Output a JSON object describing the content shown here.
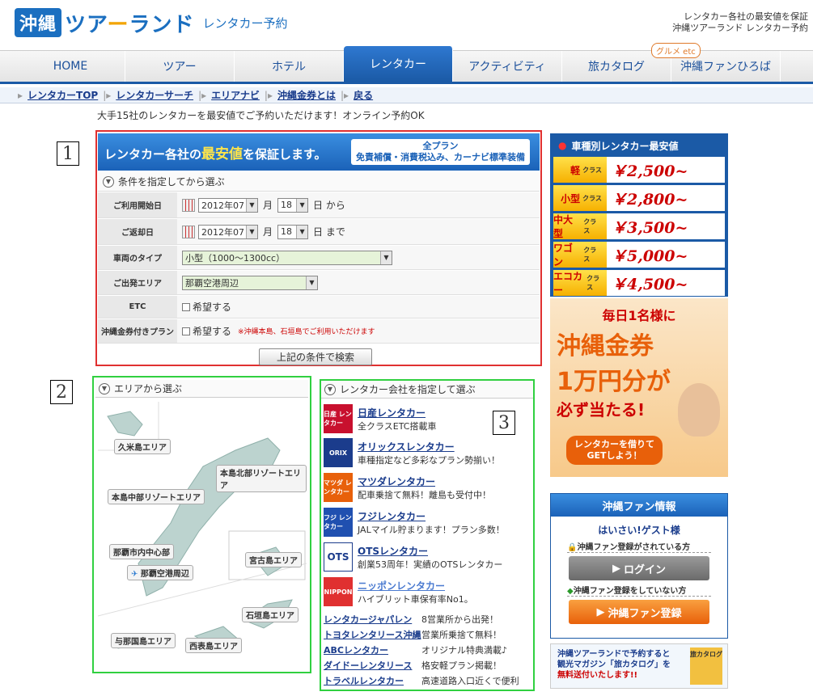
{
  "header": {
    "logo_okinawa": "沖縄",
    "logo_tour": "ツア",
    "logo_smile": "ー",
    "logo_land": "ランド",
    "logo_sub": "レンタカー予約",
    "right_line1": "レンタカー各社の最安値を保証",
    "right_line2": "沖縄ツアーランド レンタカー予約"
  },
  "nav": {
    "items": [
      "HOME",
      "ツアー",
      "ホテル",
      "レンタカー",
      "アクティビティ",
      "旅カタログ",
      "沖縄ファンひろば"
    ],
    "active": "レンタカー",
    "badge": "グルメ etc"
  },
  "subnav": {
    "items": [
      "レンタカーTOP",
      "レンタカーサーチ",
      "エリアナビ",
      "沖縄金券とは",
      "戻る"
    ]
  },
  "intro": "大手15社のレンタカーを最安値でご予約いただけます！オンライン予約OK",
  "annot": {
    "n1": "1",
    "n2": "2",
    "n3": "3"
  },
  "search": {
    "banner_pre": "レンタカー各社の",
    "banner_em": "最安値",
    "banner_post": "を保証します。",
    "banner_right1": "全プラン",
    "banner_right2": "免責補償・消費税込み、カーナビ標準装備",
    "head": "条件を指定してから選ぶ",
    "start_label": "ご利用開始日",
    "start_month": "2012年07",
    "start_day": "18",
    "month_unit": "月",
    "start_suffix": "日 から",
    "return_label": "ご返却日",
    "return_month": "2012年07",
    "return_day": "18",
    "return_suffix": "日 まで",
    "type_label": "車両のタイプ",
    "type_value": "小型（1000〜1300cc）",
    "area_label": "ご出発エリア",
    "area_value": "那覇空港周辺",
    "etc_label": "ETC",
    "etc_check": "希望する",
    "kinken_label": "沖縄金券付きプラン",
    "kinken_check": "希望する",
    "kinken_note": "※沖縄本島、石垣島でご利用いただけます",
    "button": "上記の条件で検索"
  },
  "area": {
    "head": "エリアから選ぶ",
    "labels": [
      "久米島エリア",
      "本島北部リゾートエリア",
      "本島中部リゾートエリア",
      "那覇市内中心部",
      "那覇空港周辺",
      "宮古島エリア",
      "石垣島エリア",
      "与那国島エリア",
      "西表島エリア"
    ]
  },
  "companies": {
    "head": "レンタカー会社を指定して選ぶ",
    "list": [
      {
        "logo": "日産 レンタカー",
        "name": "日産レンタカー",
        "desc": "全クラスETC搭載車",
        "color": "#c8102e"
      },
      {
        "logo": "ORIX",
        "name": "オリックスレンタカー",
        "desc": "車種指定など多彩なプラン勢揃い！",
        "color": "#1b3c8c"
      },
      {
        "logo": "マツダ レンタカー",
        "name": "マツダレンタカー",
        "desc": "配車乗捨て無料！離島も受付中！",
        "color": "#e8600a"
      },
      {
        "logo": "フジ レンタカー",
        "name": "フジレンタカー",
        "desc": "JALマイル貯まります！プラン多数！",
        "color": "#2050b0"
      },
      {
        "logo": "OTS",
        "name": "OTSレンタカー",
        "desc": "創業53周年！実績のOTSレンタカー",
        "color": "#1b3c8c"
      },
      {
        "logo": "NIPPON",
        "name": "ニッポンレンタカー",
        "desc": "ハイブリット車保有率No1。",
        "color": "#e03030"
      }
    ],
    "text_list": [
      {
        "name": "レンタカージャパレン",
        "desc": "8営業所から出発！"
      },
      {
        "name": "トヨタレンタリース沖縄",
        "desc": "営業所乗捨て無料！"
      },
      {
        "name": "ABCレンタカー",
        "desc": "オリジナル特典満載♪"
      },
      {
        "name": "ダイドーレンタリース",
        "desc": "格安軽プラン掲載！"
      },
      {
        "name": "トラベルレンタカー",
        "desc": "高速道路入口近くで便利"
      }
    ]
  },
  "prices": {
    "head": "車種別レンタカー最安値",
    "class_word": "クラス",
    "rows": [
      {
        "cls": "軽",
        "price": "￥2,500~"
      },
      {
        "cls": "小型",
        "price": "￥2,800~"
      },
      {
        "cls": "中大型",
        "price": "￥3,500~"
      },
      {
        "cls": "ワゴン",
        "price": "￥5,000~"
      },
      {
        "cls": "エコカー",
        "price": "￥4,500~"
      }
    ]
  },
  "promo": {
    "l1": "毎日1名様に",
    "l2": "沖縄金券",
    "l3": "1万円分が",
    "l4": "必ず当たる!",
    "btn1": "レンタカーを借りて",
    "btn2": "GETしよう！"
  },
  "fan": {
    "head": "沖縄ファン情報",
    "greet": "はいさい!ゲスト様",
    "note1": "沖縄ファン登録がされている方",
    "login": "ログイン",
    "note2": "沖縄ファン登録をしていない方",
    "register": "沖縄ファン登録"
  },
  "bottom_banner": {
    "l1": "沖縄ツアーランドで予約すると",
    "l2": "観光マガジン「旅カタログ」を",
    "l3": "無料送付いたします!!",
    "icon": "旅カタログ"
  },
  "colors": {
    "brand": "#1b5aa6",
    "accent": "#e8600a",
    "box1": "#e03030",
    "box2": "#30d040"
  }
}
